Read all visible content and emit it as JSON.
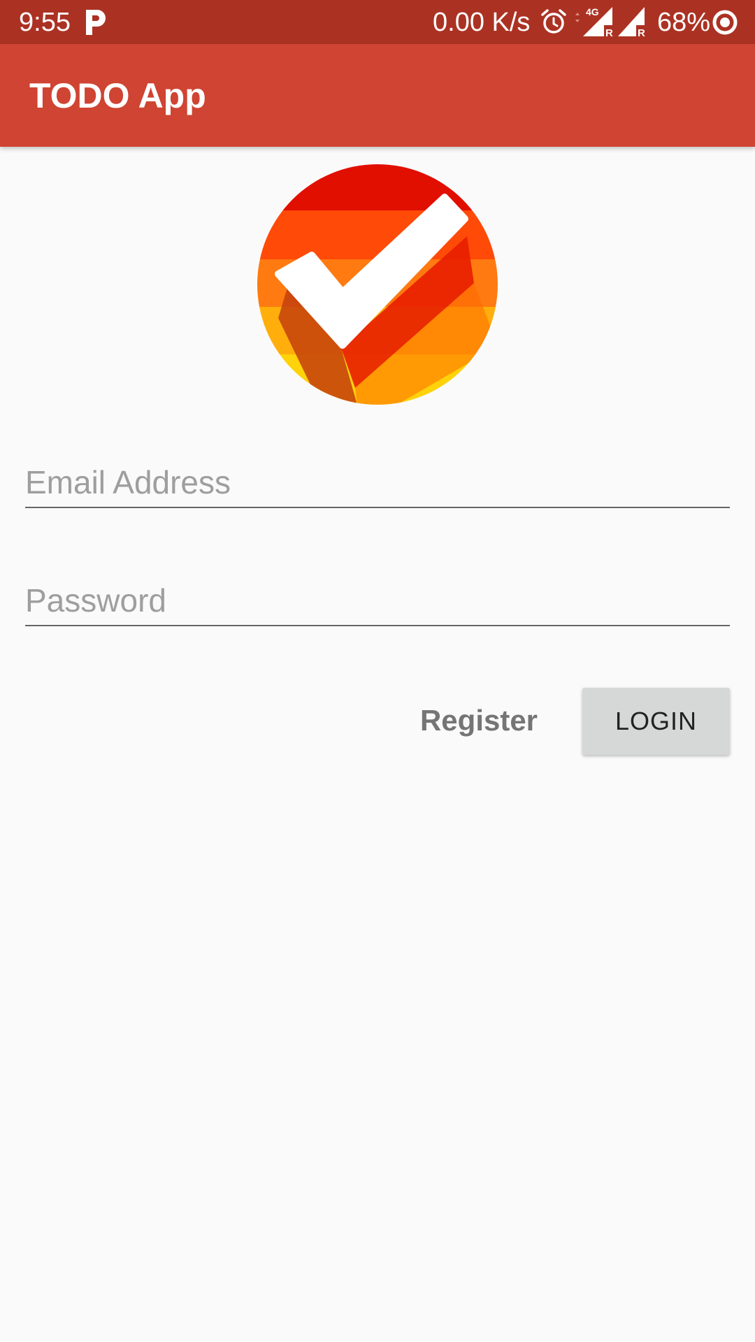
{
  "status_bar": {
    "time": "9:55",
    "network_speed": "0.00 K/s",
    "network_type": "4G",
    "roaming_mark": "R",
    "battery": "68%",
    "notification_icon": "p-icon",
    "alarm_icon": "alarm-icon",
    "battery_icon": "battery-ring-icon"
  },
  "app_bar": {
    "title": "TODO App",
    "color": "#cf4432"
  },
  "logo": {
    "icon": "checkmark-logo-icon"
  },
  "form": {
    "email_placeholder": "Email Address",
    "email_value": "",
    "password_placeholder": "Password",
    "password_value": ""
  },
  "actions": {
    "register_label": "Register",
    "login_label": "LOGIN"
  },
  "colors": {
    "status_bar": "#ab3223",
    "primary": "#cf4432",
    "background": "#fafafa",
    "button": "#d6d7d7"
  }
}
